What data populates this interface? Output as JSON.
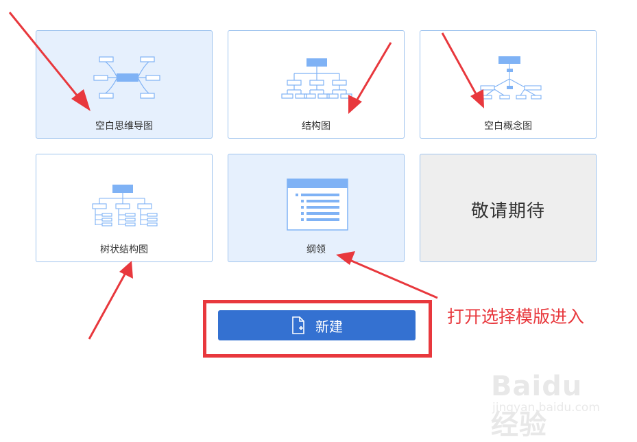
{
  "templates": [
    {
      "id": "blank-mindmap",
      "label": "空白思维导图",
      "selected": true
    },
    {
      "id": "structure",
      "label": "结构图",
      "selected": false
    },
    {
      "id": "blank-concept",
      "label": "空白概念图",
      "selected": false
    },
    {
      "id": "tree-structure",
      "label": "树状结构图",
      "selected": false
    },
    {
      "id": "outline",
      "label": "纲领",
      "selected": true
    },
    {
      "id": "coming-soon",
      "label": "敬请期待",
      "selected": false
    }
  ],
  "new_button": {
    "label": "新建",
    "icon": "new-file-icon"
  },
  "annotation": "打开选择模版进入",
  "watermark": {
    "logo": "Baidu经验",
    "sub": "jingyan.baidu.com"
  },
  "colors": {
    "accent": "#3471d1",
    "thumb_blue": "#7fb2f5",
    "annotation_red": "#e8383d",
    "card_border": "#9ec3ee"
  }
}
